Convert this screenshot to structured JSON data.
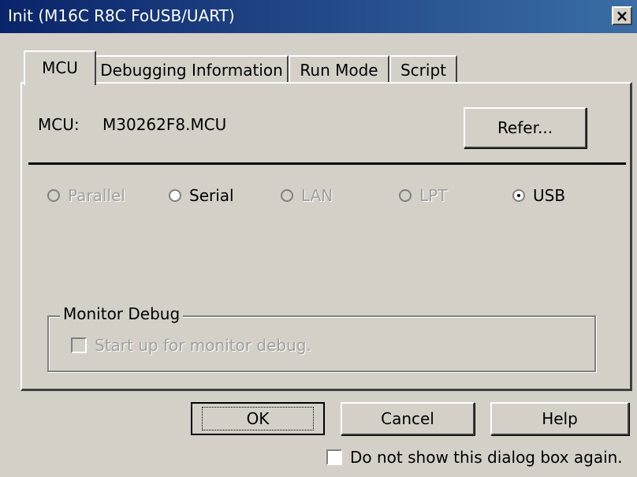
{
  "window": {
    "title": "Init (M16C R8C FoUSB/UART)",
    "close_label": "×"
  },
  "tabs": [
    {
      "label": "MCU",
      "active": true
    },
    {
      "label": "Debugging Information",
      "active": false
    },
    {
      "label": "Run Mode",
      "active": false
    },
    {
      "label": "Script",
      "active": false
    }
  ],
  "mcu": {
    "label": "MCU:",
    "value": "M30262F8.MCU",
    "refer_label": "Refer..."
  },
  "connection": {
    "options": [
      {
        "label": "Parallel",
        "enabled": false,
        "selected": false
      },
      {
        "label": "Serial",
        "enabled": true,
        "selected": false
      },
      {
        "label": "LAN",
        "enabled": false,
        "selected": false
      },
      {
        "label": "LPT",
        "enabled": false,
        "selected": false
      },
      {
        "label": "USB",
        "enabled": true,
        "selected": true
      }
    ]
  },
  "monitor_debug": {
    "group_title": "Monitor Debug",
    "checkbox_label": "Start up for monitor debug.",
    "checked": false,
    "enabled": false
  },
  "buttons": {
    "ok": "OK",
    "cancel": "Cancel",
    "help": "Help"
  },
  "footer": {
    "no_show_label": "Do not show this dialog box again.",
    "checked": false
  },
  "colors": {
    "titlebar_start": "#0a246a",
    "titlebar_end": "#3a6ea5",
    "face": "#d4d0c8"
  }
}
